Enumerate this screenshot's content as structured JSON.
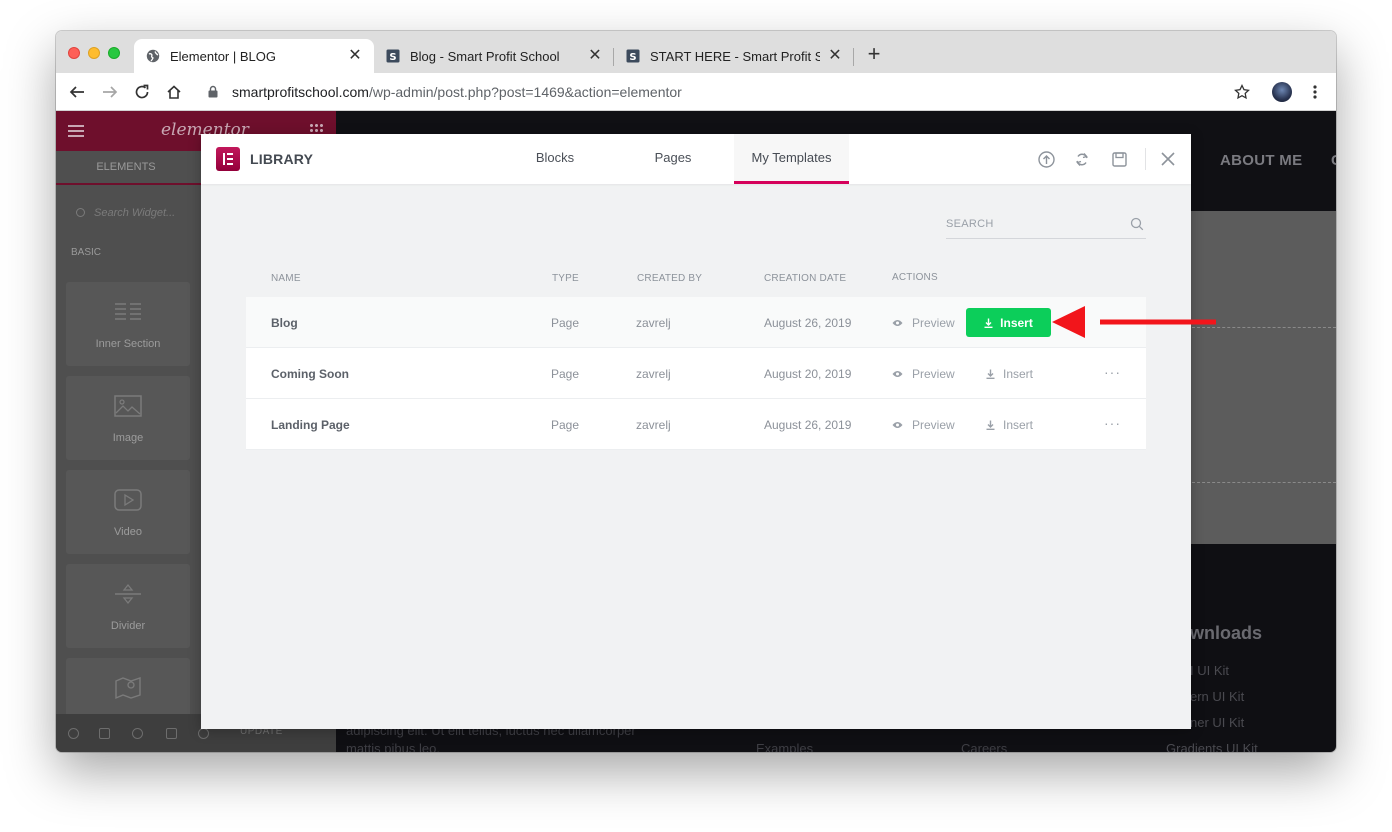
{
  "browser": {
    "tabs": [
      {
        "title": "Elementor | BLOG",
        "active": true,
        "favicon": "globe-icon"
      },
      {
        "title": "Blog - Smart Profit School",
        "active": false,
        "favicon": "site-s-icon"
      },
      {
        "title": "START HERE - Smart Profit School",
        "active": false,
        "favicon": "site-s-icon"
      }
    ],
    "url_host": "smartprofitschool.com",
    "url_path": "/wp-admin/post.php?post=1469&action=elementor"
  },
  "editor_panel": {
    "logo": "elementor",
    "tab": "ELEMENTS",
    "search_placeholder": "Search Widget...",
    "category": "BASIC",
    "widgets": [
      "Inner Section",
      "Image",
      "Video",
      "Divider",
      ""
    ],
    "update_label": "UPDATE"
  },
  "page_behind": {
    "nav_item": "ABOUT ME",
    "nav_more": "C",
    "footer_heading": "wnloads",
    "footer_links": [
      "I UI Kit",
      "ern UI Kit",
      "ner UI Kit",
      "Gradients UI Kit"
    ],
    "body_text_1": "adipiscing elit. Ut elit tellus, luctus nec ullamcorper",
    "body_text_2": "mattis pibus leo.",
    "footer_col_1": "Examples",
    "footer_col_2": "Careers"
  },
  "library": {
    "title": "LIBRARY",
    "tabs": [
      "Blocks",
      "Pages",
      "My Templates"
    ],
    "active_tab": "My Templates",
    "search_placeholder": "SEARCH",
    "columns": {
      "name": "NAME",
      "type": "TYPE",
      "created_by": "CREATED BY",
      "creation_date": "CREATION DATE",
      "actions": "ACTIONS"
    },
    "preview_label": "Preview",
    "insert_label": "Insert",
    "more_label": "···",
    "templates": [
      {
        "name": "Blog",
        "type": "Page",
        "created_by": "zavrelj",
        "date": "August 26, 2019",
        "highlighted": true
      },
      {
        "name": "Coming Soon",
        "type": "Page",
        "created_by": "zavrelj",
        "date": "August 20, 2019",
        "highlighted": false
      },
      {
        "name": "Landing Page",
        "type": "Page",
        "created_by": "zavrelj",
        "date": "August 26, 2019",
        "highlighted": false
      }
    ]
  },
  "colors": {
    "accent": "#d5005a",
    "insert_green": "#0cce5a",
    "annotation_arrow": "#f2151b"
  }
}
